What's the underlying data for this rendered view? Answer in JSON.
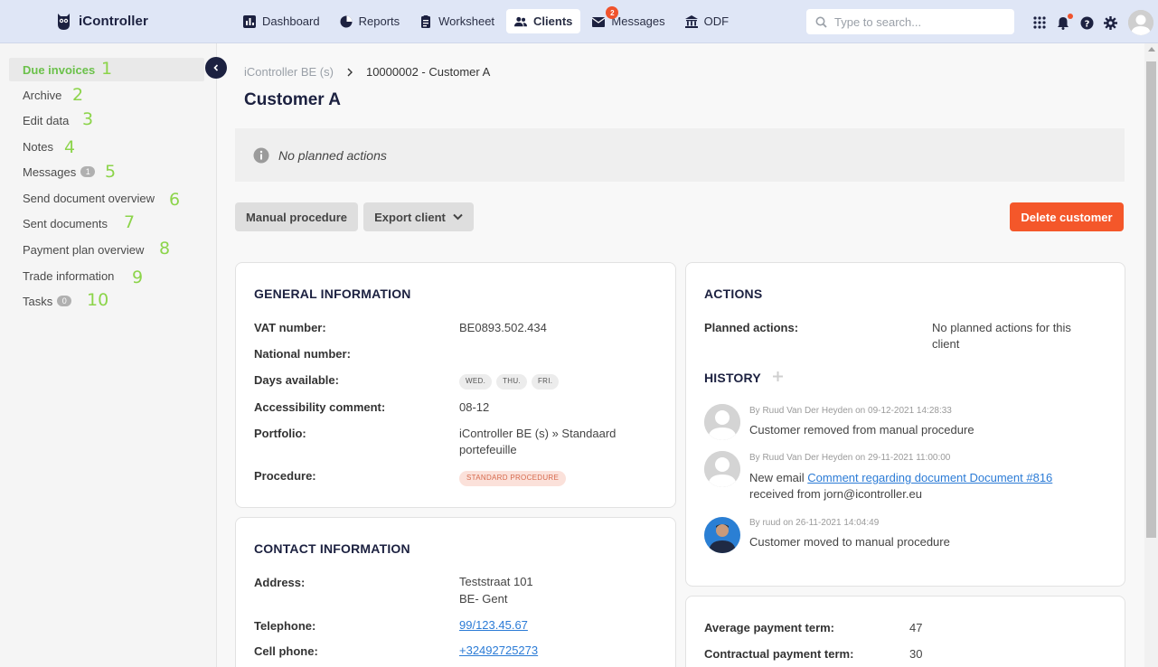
{
  "app": {
    "name": "iController"
  },
  "nav": [
    {
      "label": "Dashboard",
      "icon": "bar-chart-icon",
      "active": false
    },
    {
      "label": "Reports",
      "icon": "pie-chart-icon",
      "active": false
    },
    {
      "label": "Worksheet",
      "icon": "clipboard-icon",
      "active": false
    },
    {
      "label": "Clients",
      "icon": "users-icon",
      "active": true
    },
    {
      "label": "Messages",
      "icon": "envelope-icon",
      "active": false,
      "badge": "2"
    },
    {
      "label": "ODF",
      "icon": "bank-icon",
      "active": false
    }
  ],
  "search": {
    "placeholder": "Type to search..."
  },
  "sidebar": {
    "items": [
      {
        "label": "Due invoices",
        "number": "1",
        "active": true
      },
      {
        "label": "Archive",
        "number": "2"
      },
      {
        "label": "Edit data",
        "number": "3"
      },
      {
        "label": "Notes",
        "number": "4"
      },
      {
        "label": "Messages",
        "number": "5",
        "badge": "1"
      },
      {
        "label": "Send document overview",
        "number": "6"
      },
      {
        "label": "Sent documents",
        "number": "7"
      },
      {
        "label": "Payment plan overview",
        "number": "8"
      },
      {
        "label": "Trade information",
        "number": "9"
      },
      {
        "label": "Tasks",
        "number": "10",
        "badge": "0"
      }
    ]
  },
  "breadcrumb": {
    "parent": "iController BE (s)",
    "current": "10000002 - Customer A"
  },
  "page": {
    "title": "Customer A"
  },
  "notice": {
    "text": "No planned actions"
  },
  "buttons": {
    "manual_procedure": "Manual procedure",
    "export_client": "Export client",
    "delete_customer": "Delete customer"
  },
  "general": {
    "title": "GENERAL INFORMATION",
    "vat_label": "VAT number:",
    "vat_value": "BE0893.502.434",
    "national_label": "National number:",
    "days_label": "Days available:",
    "days": [
      "WED.",
      "THU.",
      "FRI."
    ],
    "access_label": "Accessibility comment:",
    "access_value": "08-12",
    "portfolio_label": "Portfolio:",
    "portfolio_value_1": "iController BE (s) » Standaard",
    "portfolio_value_2": "portefeuille",
    "procedure_label": "Procedure:",
    "procedure_value": "STANDARD PROCEDURE"
  },
  "contact": {
    "title": "CONTACT INFORMATION",
    "address_label": "Address:",
    "address_1": "Teststraat 101",
    "address_2": "BE- Gent",
    "phone_label": "Telephone:",
    "phone_value": "99/123.45.67",
    "cell_label": "Cell phone:",
    "cell_value": "+32492725273"
  },
  "actions": {
    "title": "ACTIONS",
    "planned_label": "Planned actions:",
    "planned_value_1": "No planned actions for this",
    "planned_value_2": "client",
    "history_title": "HISTORY",
    "history": [
      {
        "meta": "By Ruud Van Der Heyden on 09-12-2021 14:28:33",
        "text": "Customer removed from manual procedure"
      },
      {
        "meta": "By Ruud Van Der Heyden on 29-11-2021 11:00:00",
        "text_prefix": "New email ",
        "link": "Comment regarding document Document #816",
        "text_suffix": "received from jorn@icontroller.eu"
      },
      {
        "meta": "By ruud on 26-11-2021 14:04:49",
        "text": "Customer moved to manual procedure"
      }
    ]
  },
  "payment": {
    "avg_label": "Average payment term:",
    "avg_value": "47",
    "contract_label": "Contractual payment term:",
    "contract_value": "30"
  },
  "colors": {
    "accent": "#6bc14a",
    "danger": "#f4572a",
    "navy": "#1c2140",
    "topbar": "#dfe6f6"
  }
}
